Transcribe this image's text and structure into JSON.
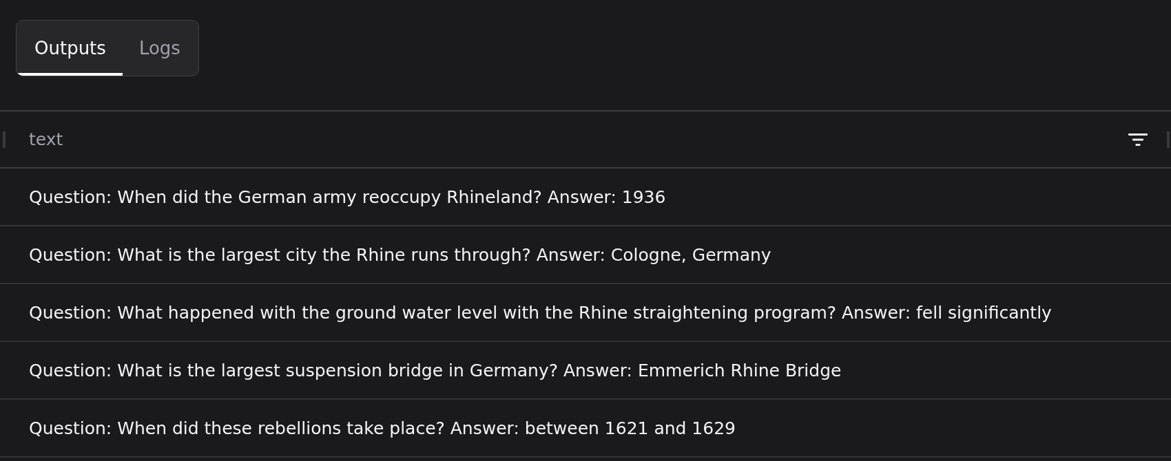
{
  "tabs": [
    {
      "label": "Outputs",
      "selected": true
    },
    {
      "label": "Logs",
      "selected": false
    }
  ],
  "table": {
    "columns": [
      {
        "label": "text"
      }
    ],
    "rows": [
      {
        "text": "Question: When did the German army reoccupy Rhineland? Answer: 1936"
      },
      {
        "text": "Question: What is the largest city the Rhine runs through? Answer: Cologne, Germany"
      },
      {
        "text": "Question: What happened with the ground water level with the Rhine straightening program? Answer: fell significantly"
      },
      {
        "text": "Question: What is the largest suspension bridge in Germany? Answer: Emmerich Rhine Bridge"
      },
      {
        "text": "Question: When did these rebellions take place? Answer: between 1621 and 1629"
      }
    ]
  }
}
